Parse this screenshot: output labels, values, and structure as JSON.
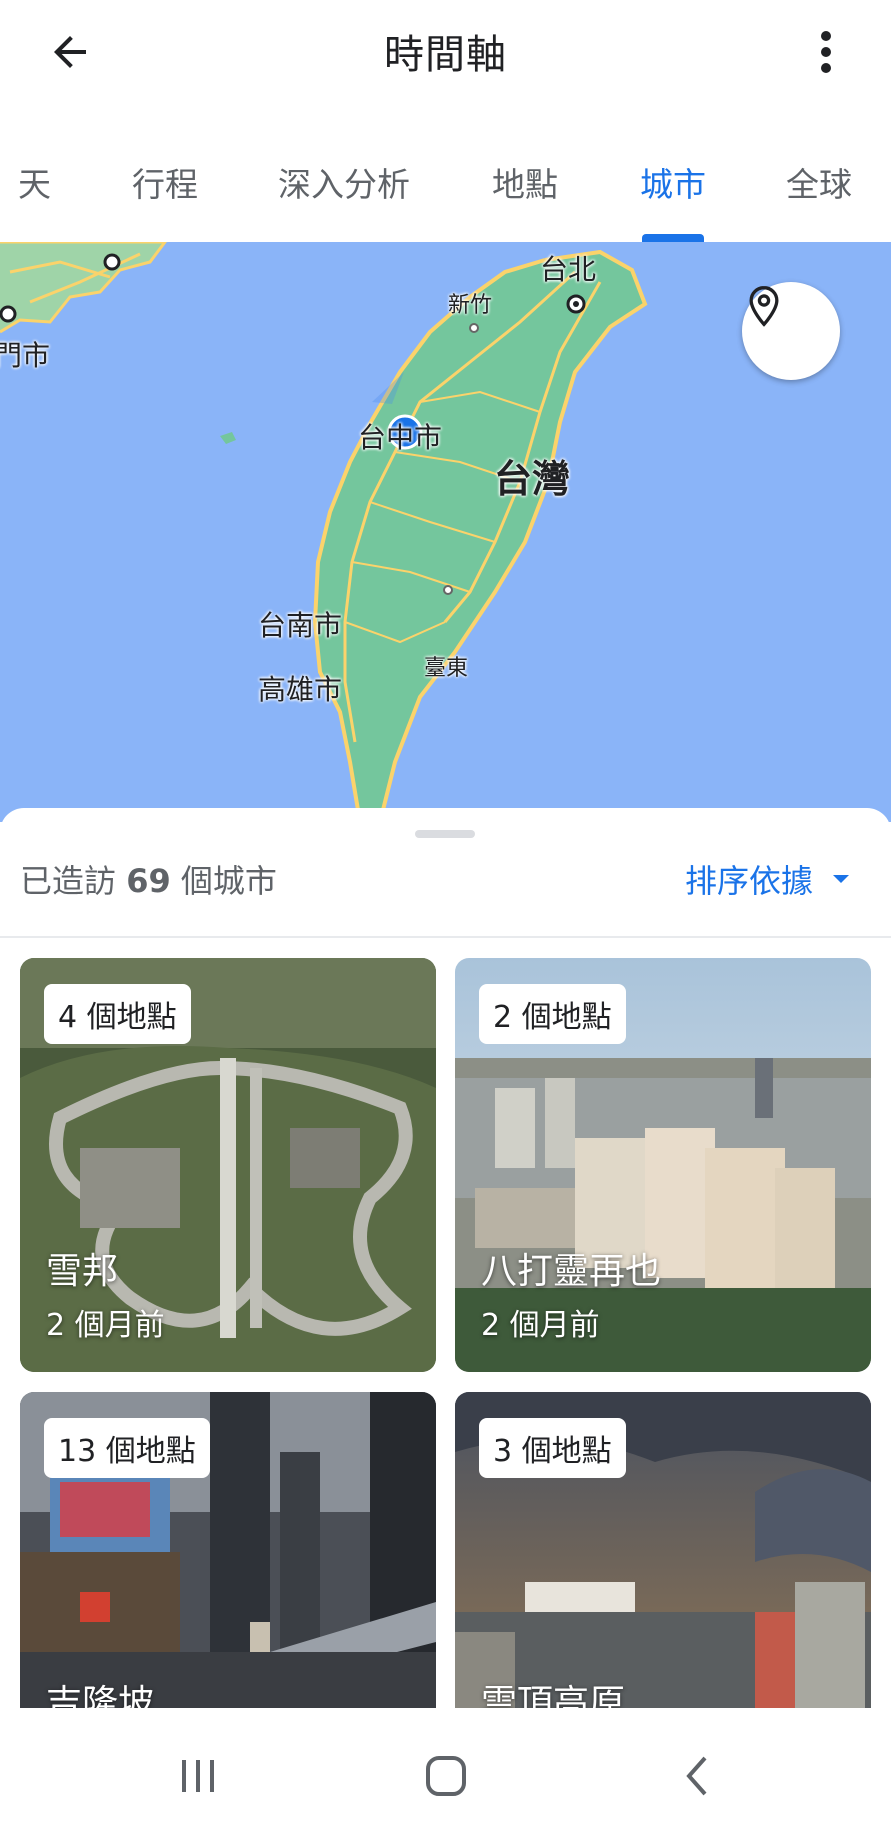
{
  "header": {
    "title": "時間軸",
    "back_icon": "arrow-back-icon",
    "more_icon": "more-vert-icon"
  },
  "tabs": [
    {
      "label": "天"
    },
    {
      "label": "行程"
    },
    {
      "label": "深入分析"
    },
    {
      "label": "地點"
    },
    {
      "label": "城市",
      "active": true
    },
    {
      "label": "全球"
    }
  ],
  "map": {
    "labels": {
      "taipei": "台北",
      "hsinchu": "新竹",
      "taichung": "台中市",
      "taiwan": "台灣",
      "tainan": "台南市",
      "kaohsiung": "高雄市",
      "taitung": "臺東",
      "xiamen": "門市"
    },
    "locate_icon": "location-pin-icon",
    "colors": {
      "water": "#8ab4f8",
      "land": "#74c69d",
      "road": "#fbd36b",
      "dot": "#1a73e8"
    }
  },
  "summary": {
    "prefix": "已造訪",
    "count": "69",
    "suffix": "個城市",
    "sort_label": "排序依據"
  },
  "cities": [
    {
      "count_label": "4 個地點",
      "name": "雪邦",
      "time": "2 個月前"
    },
    {
      "count_label": "2 個地點",
      "name": "八打靈再也",
      "time": "2 個月前"
    },
    {
      "count_label": "13 個地點",
      "name": "吉隆坡",
      "time": ""
    },
    {
      "count_label": "3 個地點",
      "name": "雲頂高原",
      "time": ""
    }
  ],
  "navbar": {
    "recents_icon": "recents-icon",
    "home_icon": "home-icon",
    "back_icon": "nav-back-icon"
  }
}
